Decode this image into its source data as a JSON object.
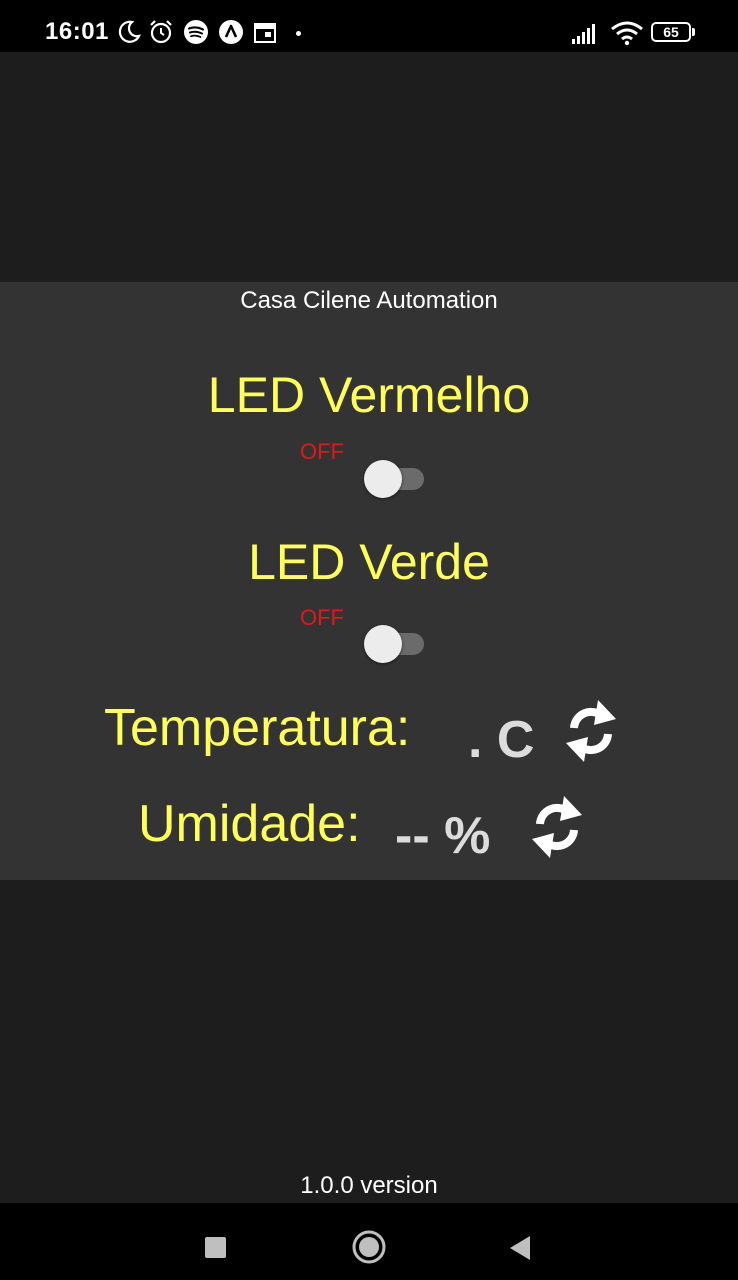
{
  "status_bar": {
    "time": "16:01",
    "battery": "65",
    "icons": [
      "moon-icon",
      "alarm-icon",
      "spotify-icon",
      "app-icon",
      "calendar-icon",
      "signal-icon",
      "wifi-icon",
      "battery-icon"
    ]
  },
  "app": {
    "title": "Casa Cilene Automation",
    "version": "1.0.0 version"
  },
  "leds": [
    {
      "name": "LED Vermelho",
      "state": "OFF",
      "on": false
    },
    {
      "name": "LED Verde",
      "state": "OFF",
      "on": false
    }
  ],
  "sensors": {
    "temperature": {
      "label": "Temperatura:",
      "value": ". C"
    },
    "humidity": {
      "label": "Umidade:",
      "value": "-- %"
    }
  },
  "colors": {
    "accent_yellow": "#ffff55",
    "off_red": "#e01818",
    "panel_bg": "#333333",
    "screen_bg": "#1d1d1d"
  },
  "nav_bar": {
    "icons": [
      "recents-icon",
      "home-icon",
      "back-icon"
    ]
  }
}
